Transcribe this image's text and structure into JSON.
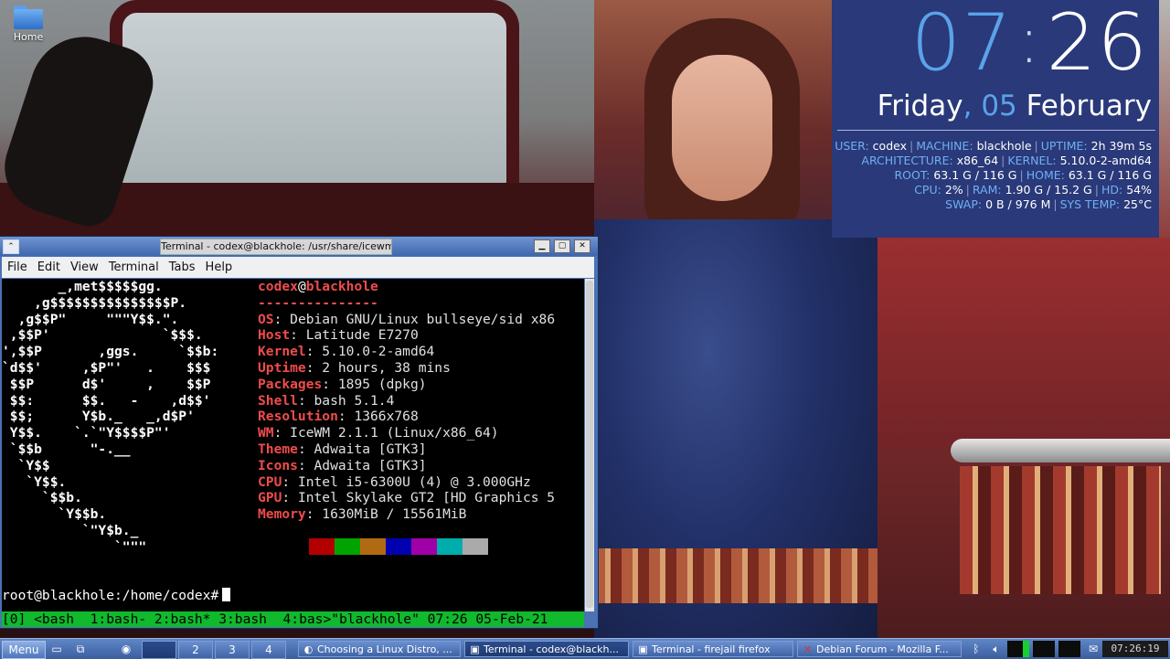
{
  "desktop": {
    "home_icon_label": "Home"
  },
  "conky": {
    "hour": "07",
    "separator": ":",
    "minute": "26",
    "weekday": "Friday",
    "comma": ",",
    "day": "05",
    "month": "February",
    "rows": [
      [
        [
          "USER:",
          "codex"
        ],
        [
          "MACHINE:",
          "blackhole"
        ],
        [
          "UPTIME:",
          "2h 39m 5s"
        ]
      ],
      [
        [
          "ARCHITECTURE:",
          "x86_64"
        ],
        [
          "KERNEL:",
          "5.10.0-2-amd64"
        ]
      ],
      [
        [
          "ROOT:",
          "63.1 G / 116 G"
        ],
        [
          "HOME:",
          "63.1 G / 116 G"
        ]
      ],
      [
        [
          "CPU:",
          "2%"
        ],
        [
          "RAM:",
          "1.90 G / 15.2 G"
        ],
        [
          "HD:",
          "54%"
        ]
      ],
      [
        [
          "SWAP:",
          "0 B / 976 M"
        ],
        [
          "SYS TEMP:",
          "25°C"
        ]
      ]
    ],
    "colors": {
      "background": "#2a3979",
      "accent": "#5aa3ea"
    }
  },
  "terminal_window": {
    "title": "Terminal - codex@blackhole: /usr/share/icewm",
    "menu": [
      "File",
      "Edit",
      "View",
      "Terminal",
      "Tabs",
      "Help"
    ],
    "logo_lines": [
      "       _,met$$$$$gg.",
      "    ,g$$$$$$$$$$$$$$$P.",
      "  ,g$$P\"     \"\"\"Y$$.\".",
      " ,$$P'              `$$$.",
      "',$$P       ,ggs.     `$$b:",
      "`d$$'     ,$P\"'   .    $$$",
      " $$P      d$'     ,    $$P",
      " $$:      $$.   -    ,d$$'",
      " $$;      Y$b._   _,d$P'",
      " Y$$.    `.`\"Y$$$$P\"'",
      " `$$b      \"-.__",
      "  `Y$$",
      "   `Y$$.",
      "     `$$b.",
      "       `Y$$b.",
      "          `\"Y$b._",
      "              `\"\"\""
    ],
    "user": "codex",
    "at": "@",
    "host": "blackhole",
    "divider": "---------------",
    "info": [
      [
        "OS",
        "Debian GNU/Linux bullseye/sid x86"
      ],
      [
        "Host",
        "Latitude E7270"
      ],
      [
        "Kernel",
        "5.10.0-2-amd64"
      ],
      [
        "Uptime",
        "2 hours, 38 mins"
      ],
      [
        "Packages",
        "1895 (dpkg)"
      ],
      [
        "Shell",
        "bash 5.1.4"
      ],
      [
        "Resolution",
        "1366x768"
      ],
      [
        "WM",
        "IceWM 2.1.1 (Linux/x86_64)"
      ],
      [
        "Theme",
        "Adwaita [GTK3]"
      ],
      [
        "Icons",
        "Adwaita [GTK3]"
      ],
      [
        "CPU",
        "Intel i5-6300U (4) @ 3.000GHz"
      ],
      [
        "GPU",
        "Intel Skylake GT2 [HD Graphics 5"
      ],
      [
        "Memory",
        "1630MiB / 15561MiB"
      ]
    ],
    "palette": [
      "#000000",
      "#b20000",
      "#00a300",
      "#b26a12",
      "#0000b0",
      "#a000a8",
      "#00adad",
      "#aaaaaa"
    ],
    "prompt": "root@blackhole:/home/codex#",
    "tmux_status": "[0] <bash  1:bash- 2:bash* 3:bash  4:bas>\"blackhole\" 07:26 05-Feb-21"
  },
  "taskbar": {
    "menu_label": "Menu",
    "workspaces": [
      "1",
      "2",
      "3",
      "4"
    ],
    "active_workspace": "1",
    "tasks": [
      {
        "label": "Choosing a Linux Distro, ...",
        "icon": "firefox-icon",
        "active": false
      },
      {
        "label": "Terminal - codex@blackh...",
        "icon": "terminal-icon",
        "active": true
      },
      {
        "label": "Terminal - firejail firefox",
        "icon": "terminal-icon",
        "active": false
      },
      {
        "label": "Debian Forum - Mozilla F...",
        "icon": "debian-icon",
        "active": false
      }
    ],
    "clock": "07:26:19",
    "colors": {
      "bar": "#4a6fb1",
      "cpu_meter": "#16d02e"
    }
  }
}
